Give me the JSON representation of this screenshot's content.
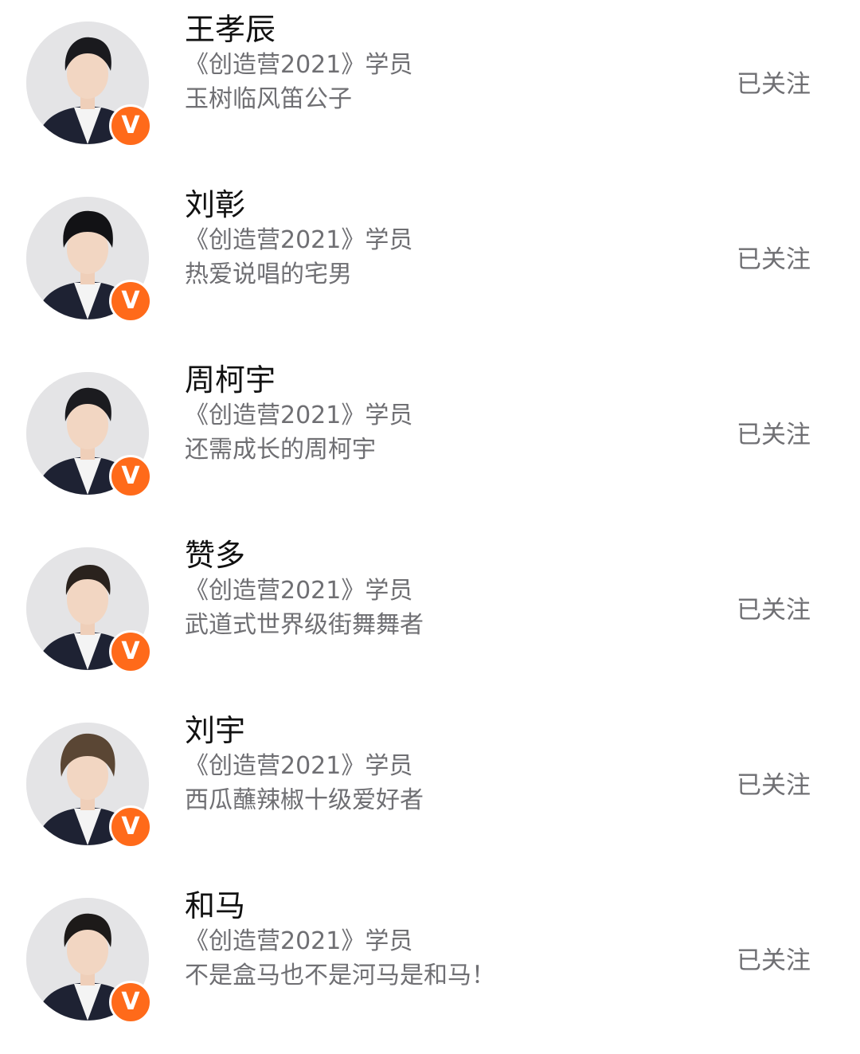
{
  "users": [
    {
      "name": "王孝辰",
      "title": "《创造营2021》学员",
      "bio": "玉树临风笛公子",
      "follow_label": "已关注",
      "badge": "V",
      "hair": "#1a1a1e"
    },
    {
      "name": "刘彰",
      "title": "《创造营2021》学员",
      "bio": "热爱说唱的宅男",
      "follow_label": "已关注",
      "badge": "V",
      "hair": "#121215"
    },
    {
      "name": "周柯宇",
      "title": "《创造营2021》学员",
      "bio": "还需成长的周柯宇",
      "follow_label": "已关注",
      "badge": "V",
      "hair": "#1b1b1f"
    },
    {
      "name": "赞多",
      "title": "《创造营2021》学员",
      "bio": "武道式世界级街舞舞者",
      "follow_label": "已关注",
      "badge": "V",
      "hair": "#2a221d"
    },
    {
      "name": "刘宇",
      "title": "《创造营2021》学员",
      "bio": "西瓜蘸辣椒十级爱好者",
      "follow_label": "已关注",
      "badge": "V",
      "hair": "#5a4634"
    },
    {
      "name": "和马",
      "title": "《创造营2021》学员",
      "bio": "不是盒马也不是河马是和马！",
      "follow_label": "已关注",
      "badge": "V",
      "hair": "#1d1a19"
    }
  ],
  "colors": {
    "badge": "#ff6a1a",
    "secondary_text": "#6f6f73",
    "primary_text": "#111111"
  }
}
